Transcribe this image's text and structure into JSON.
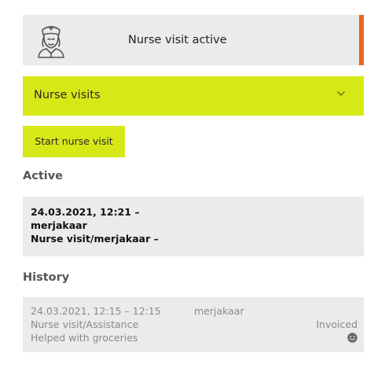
{
  "banner": {
    "title": "Nurse visit active",
    "icon": "nurse-icon",
    "accent_color": "#e8661e"
  },
  "nurse_visits": {
    "label": "Nurse visits",
    "icon": "chevron-down-icon",
    "background_color": "#d6e816"
  },
  "start_button": {
    "label": "Start nurse visit"
  },
  "active": {
    "heading": "Active",
    "items": [
      {
        "time": "24.03.2021, 12:21 –",
        "user": "merjakaar",
        "title": "Nurse visit/merjakaar –"
      }
    ]
  },
  "history": {
    "heading": "History",
    "items": [
      {
        "time": "24.03.2021, 12:15 – 12:15",
        "user": "merjakaar",
        "title": "Nurse visit/Assistance",
        "note": "Helped with groceries",
        "status": "Invoiced",
        "status_icon": "smiley-icon"
      }
    ]
  }
}
